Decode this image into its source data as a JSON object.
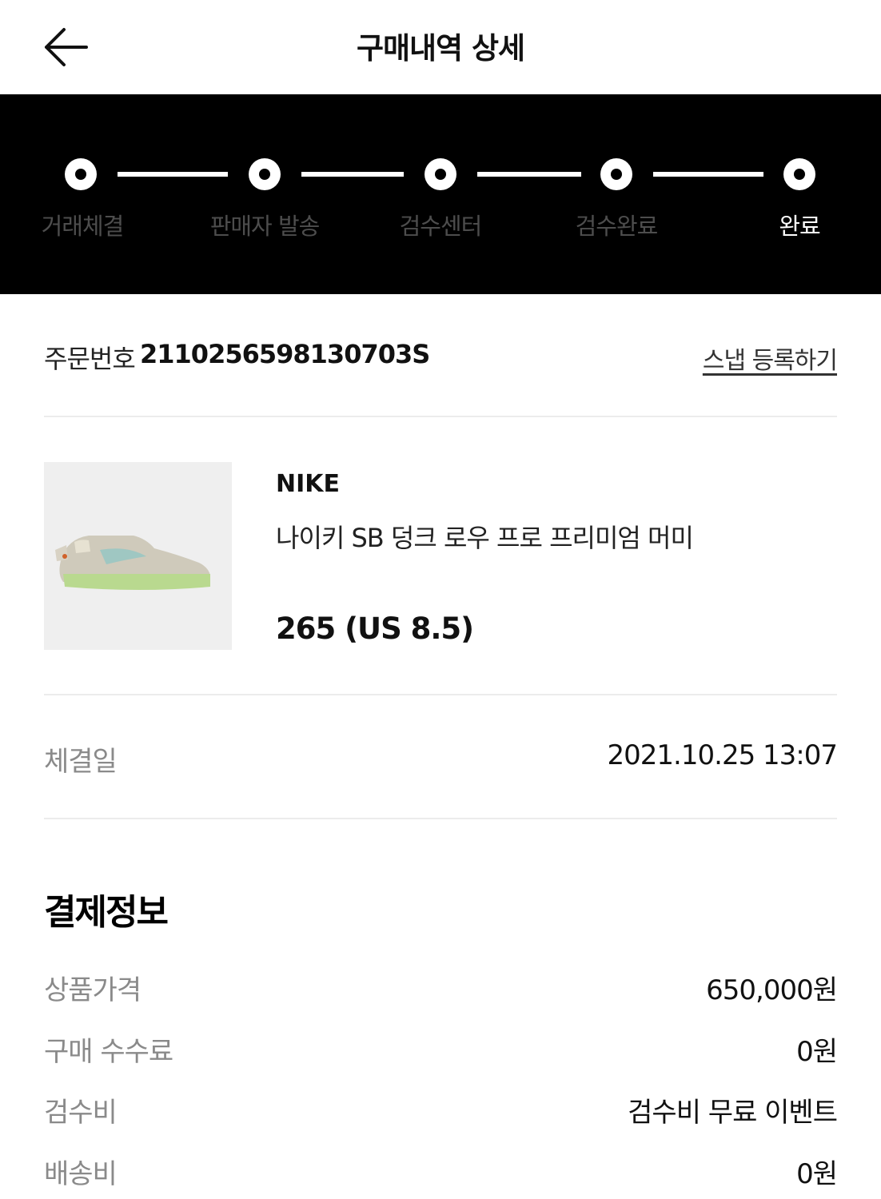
{
  "header": {
    "title": "구매내역 상세",
    "back_icon": "arrow-left-icon"
  },
  "progress": {
    "steps": [
      {
        "label": "거래체결",
        "active": false
      },
      {
        "label": "판매자 발송",
        "active": false
      },
      {
        "label": "검수센터",
        "active": false
      },
      {
        "label": "검수완료",
        "active": false
      },
      {
        "label": "완료",
        "active": true
      }
    ]
  },
  "order": {
    "label": "주문번호",
    "number": "2110256598130703S",
    "snap_link": "스냅 등록하기"
  },
  "product": {
    "brand": "NIKE",
    "name": "나이키 SB 덩크 로우 프로 프리미엄 머미",
    "size": "265 (US 8.5)"
  },
  "deal": {
    "label": "체결일",
    "value": "2021.10.25 13:07"
  },
  "payment": {
    "title": "결제정보",
    "rows": [
      {
        "label": "상품가격",
        "value": "650,000원"
      },
      {
        "label": "구매 수수료",
        "value": "0원"
      },
      {
        "label": "검수비",
        "value": "검수비 무료 이벤트"
      },
      {
        "label": "배송비",
        "value": "0원"
      }
    ]
  }
}
